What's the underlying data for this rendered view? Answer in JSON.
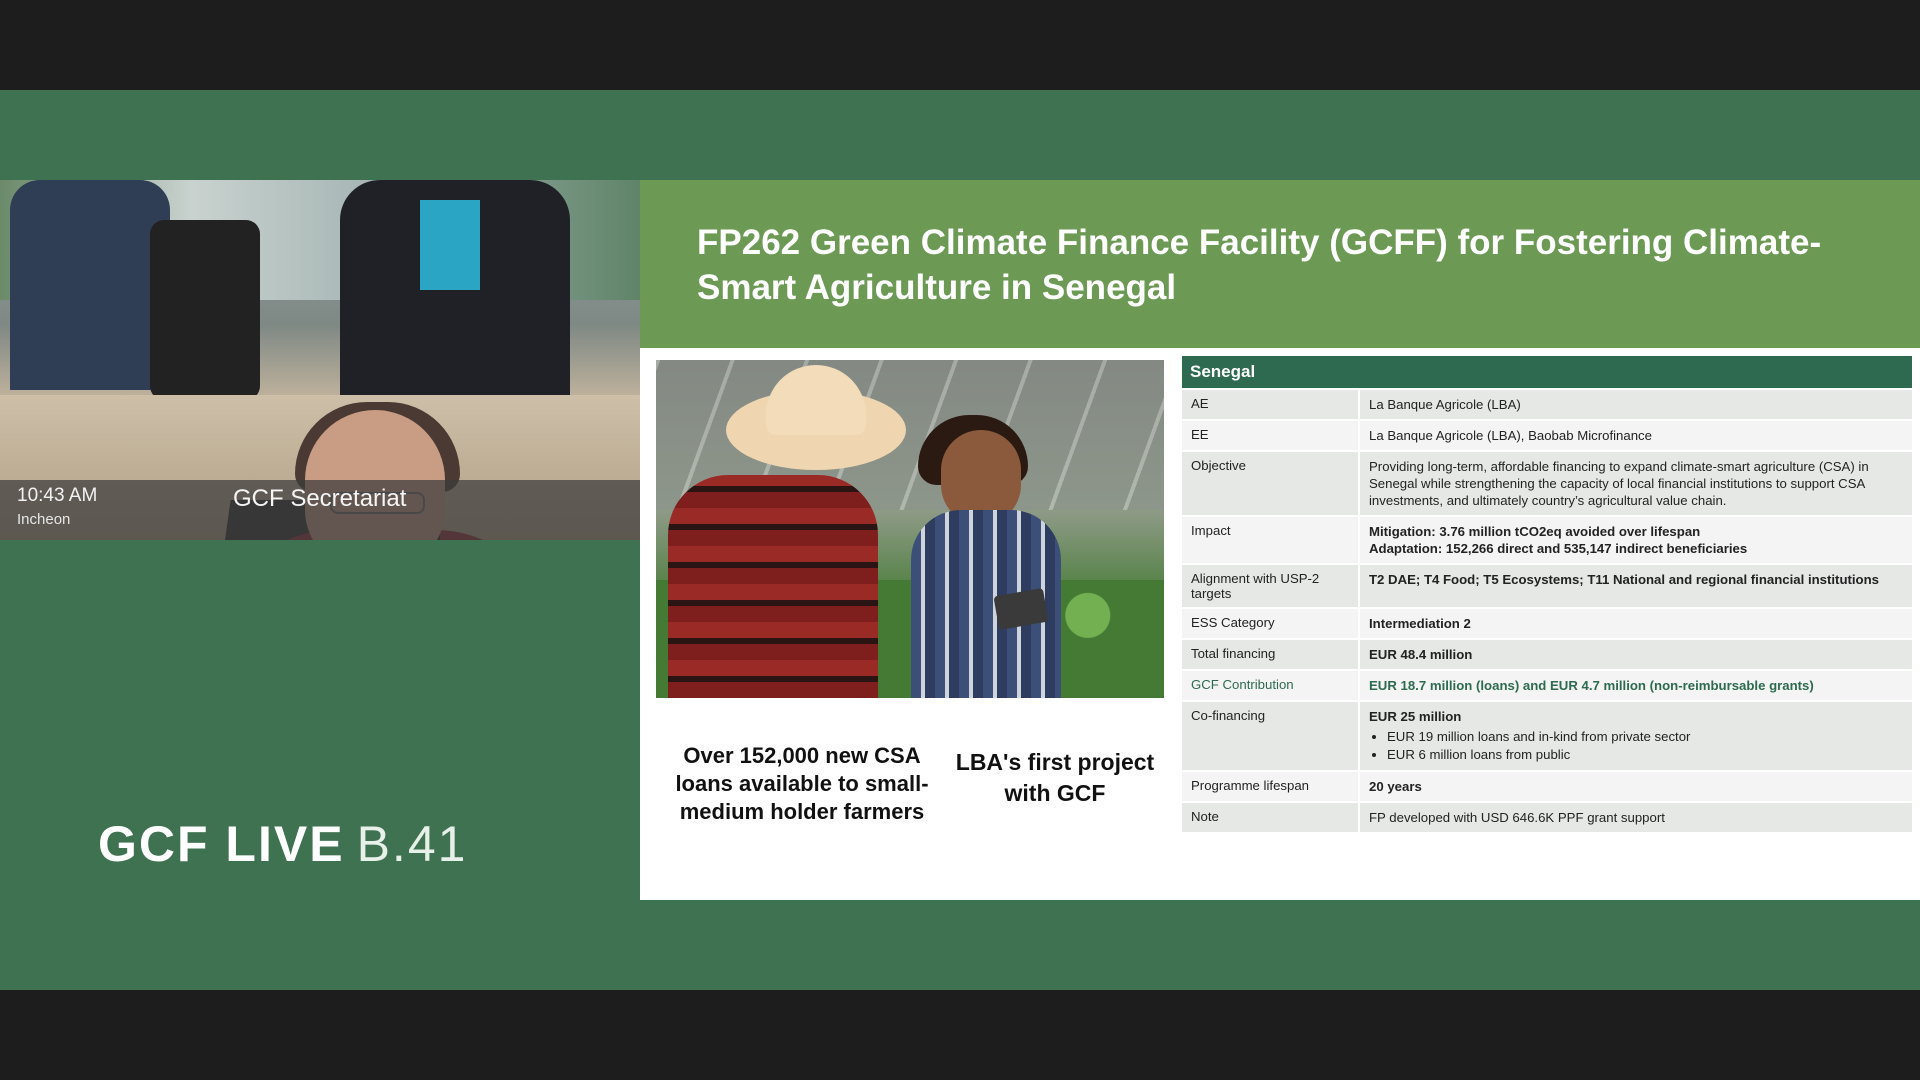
{
  "video": {
    "time": "10:43 AM",
    "location": "Incheon",
    "speaker": "GCF Secretariat"
  },
  "branding": {
    "strong": "GCF LIVE",
    "light": "B.41"
  },
  "slide": {
    "title": "FP262 Green Climate Finance Facility (GCFF) for Fostering Climate-Smart Agriculture in Senegal",
    "stat_one": "Over 152,000 new CSA loans available to small-medium holder farmers",
    "stat_two": "LBA's first project with GCF",
    "table": {
      "header": "Senegal",
      "rows": [
        {
          "key": "AE",
          "value": "La Banque Agricole (LBA)"
        },
        {
          "key": "EE",
          "value": "La Banque Agricole (LBA), Baobab Microfinance"
        },
        {
          "key": "Objective",
          "value": "Providing long-term, affordable financing to expand climate-smart agriculture (CSA) in Senegal while strengthening the capacity of local financial institutions to support CSA investments, and ultimately country’s agricultural value chain."
        },
        {
          "key": "Impact",
          "line1": "Mitigation: 3.76 million tCO2eq avoided over lifespan",
          "line2": "Adaptation: 152,266 direct and 535,147 indirect beneficiaries"
        },
        {
          "key": "Alignment with USP-2 targets",
          "value": "T2 DAE;  T4 Food; T5 Ecosystems; T11 National and regional financial institutions"
        },
        {
          "key": "ESS Category",
          "value": "Intermediation 2"
        },
        {
          "key": "Total financing",
          "value": "EUR 48.4 million"
        },
        {
          "key": "GCF Contribution",
          "value": "EUR 18.7 million (loans) and EUR 4.7 million (non-reimbursable grants)"
        },
        {
          "key": "Co-financing",
          "value": "EUR 25 million",
          "bullet1": "EUR 19 million loans and in-kind from private sector",
          "bullet2": "EUR 6 million loans from public"
        },
        {
          "key": "Programme lifespan",
          "value": "20 years"
        },
        {
          "key": "Note",
          "value": "FP developed with USD 646.6K PPF grant support"
        }
      ]
    }
  },
  "colors": {
    "stage_green": "#3e7250",
    "header_green": "#6c9a55",
    "table_header": "#2d6a4f",
    "caption_bar": "#3c3c3c"
  }
}
